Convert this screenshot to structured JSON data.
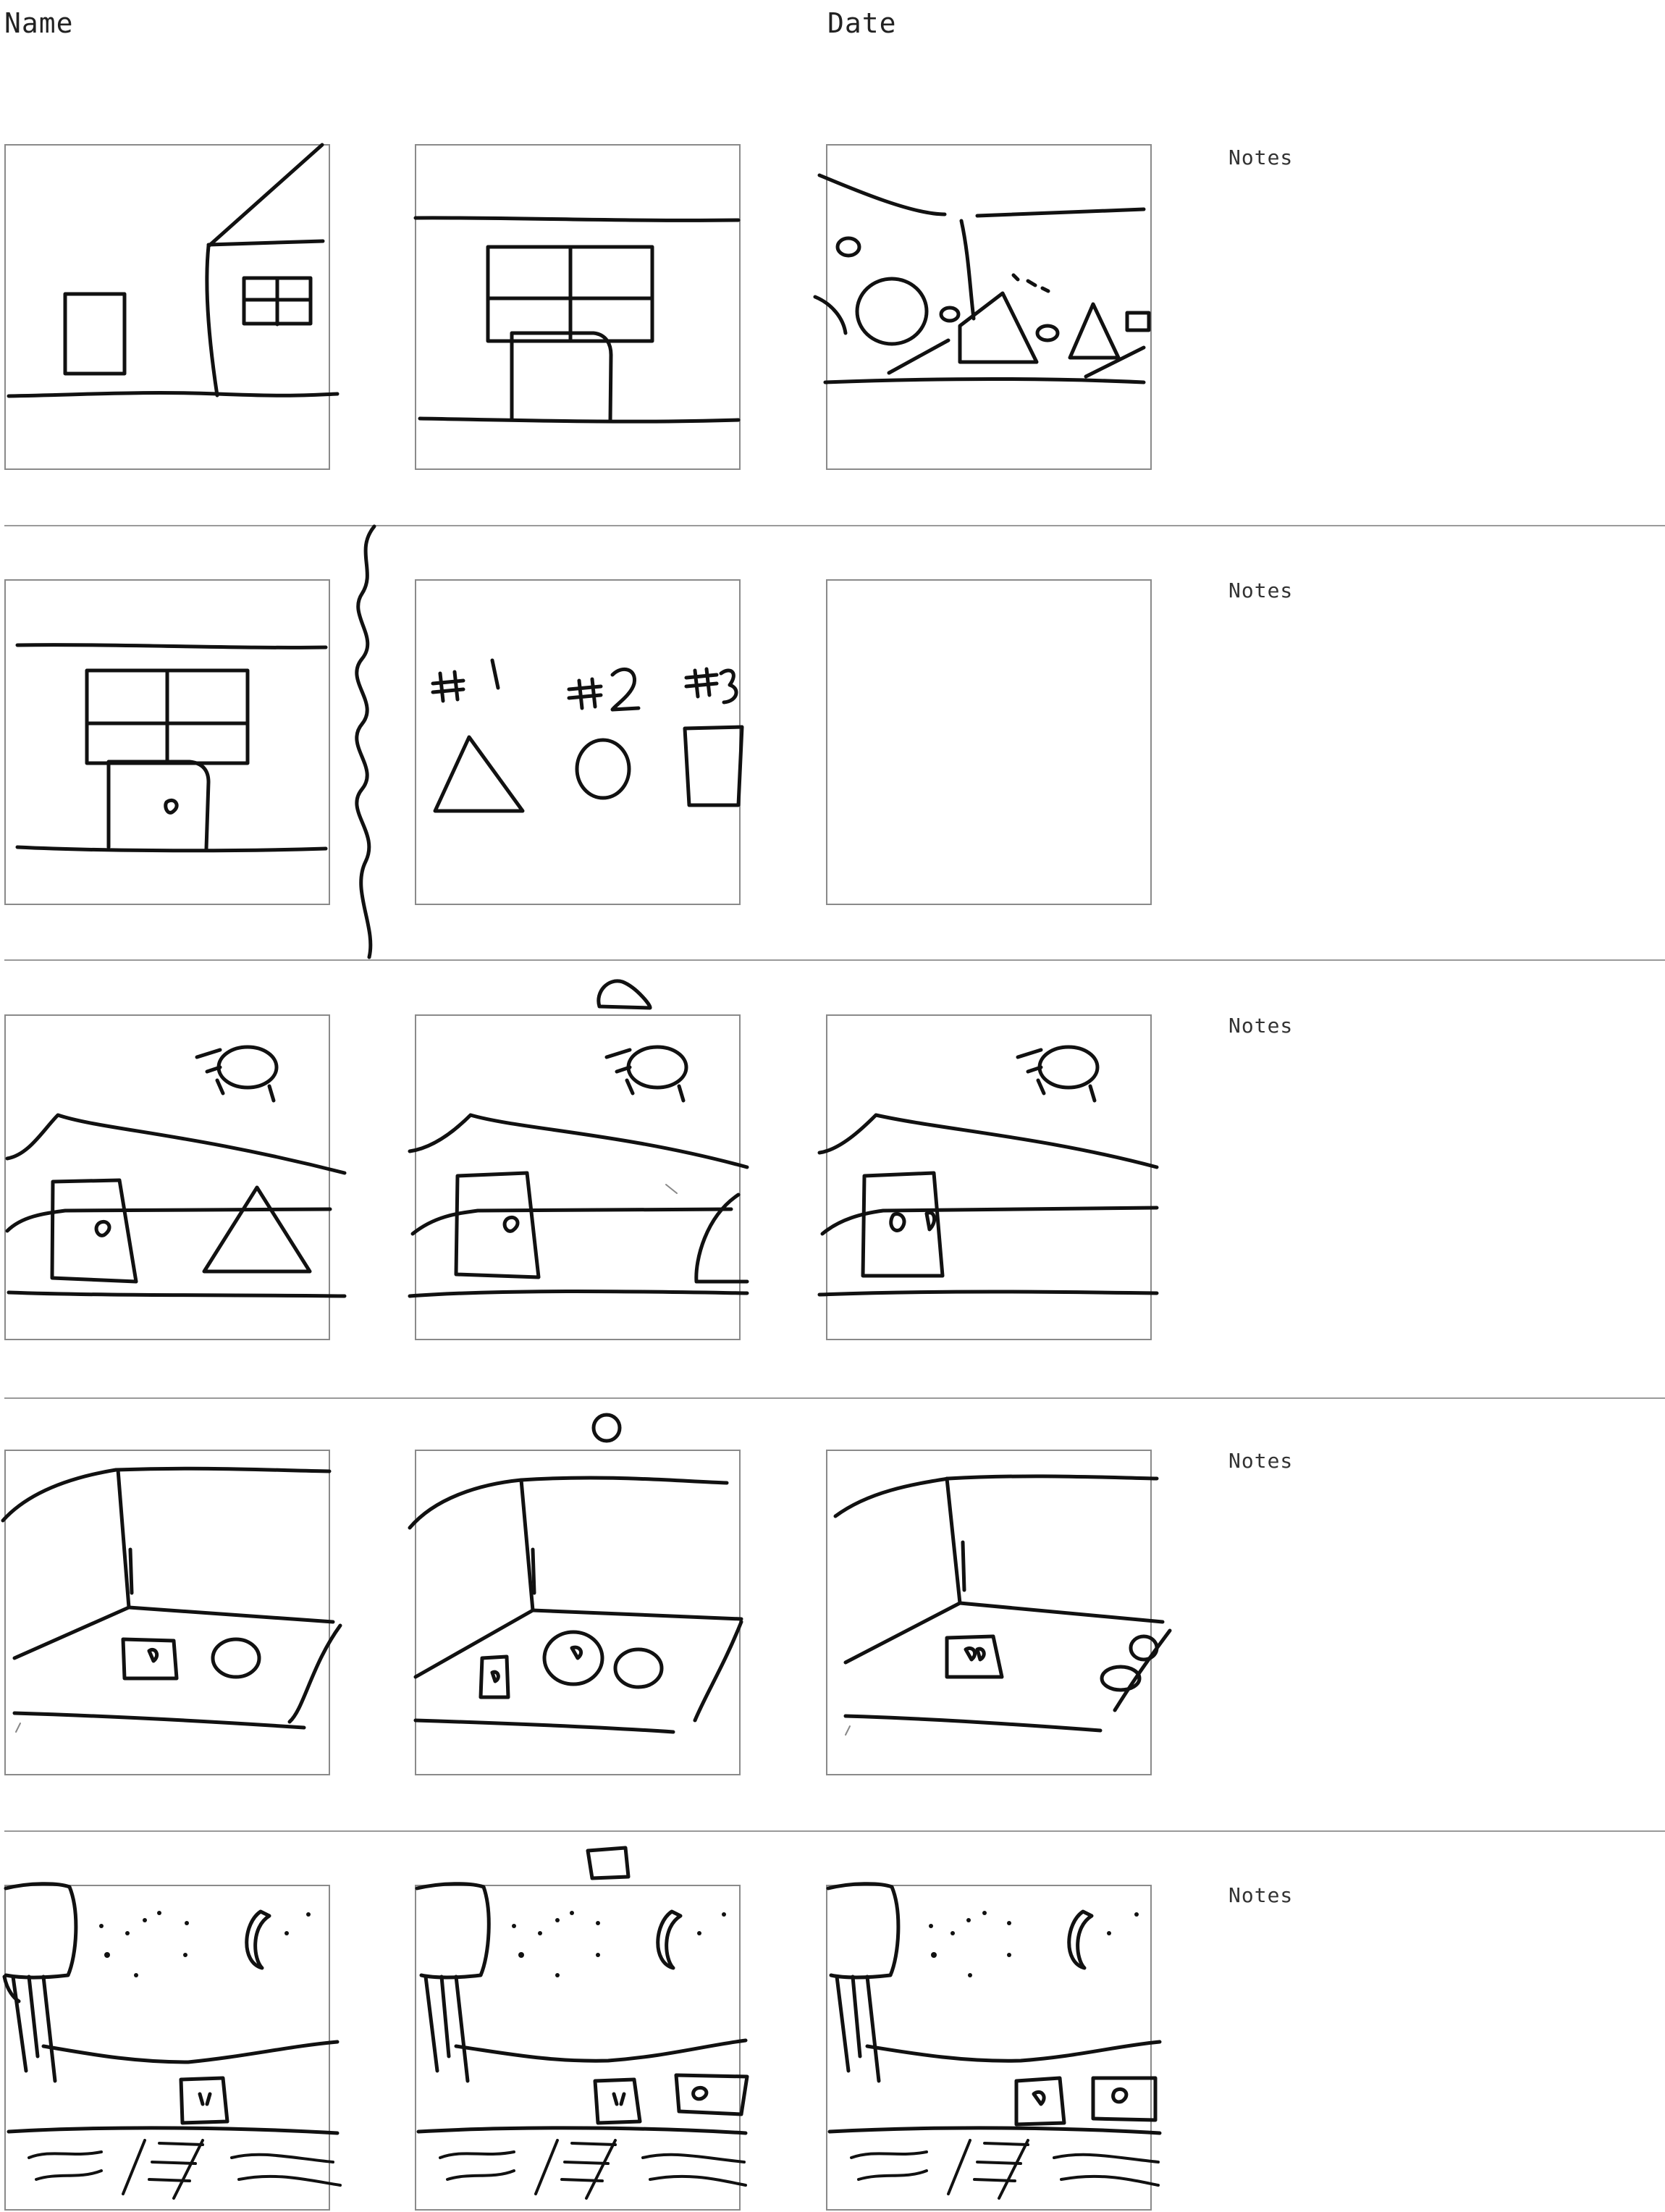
{
  "header": {
    "name_label": "Name",
    "date_label": "Date"
  },
  "rows": [
    {
      "notes_label": "Notes"
    },
    {
      "notes_label": "Notes"
    },
    {
      "notes_label": "Notes"
    },
    {
      "notes_label": "Notes"
    },
    {
      "notes_label": "Notes"
    }
  ],
  "panel_contents": {
    "row1": [
      "house-exterior-with-window",
      "door-below-window",
      "rocks-and-triangles-scene"
    ],
    "row2": [
      "door-with-heart-below-window",
      "shapes-numbered",
      "empty-panel"
    ],
    "row3": [
      "hill-scene-door-triangle",
      "hill-scene-door",
      "hill-scene-door"
    ],
    "row4": [
      "room-door-circle",
      "room-door-two-circles",
      "room-door-circles"
    ],
    "row5": [
      "night-scene-door",
      "night-scene-door-box",
      "night-scene-door-box"
    ]
  },
  "shape_labels": [
    "#1",
    "#2",
    "#3"
  ]
}
